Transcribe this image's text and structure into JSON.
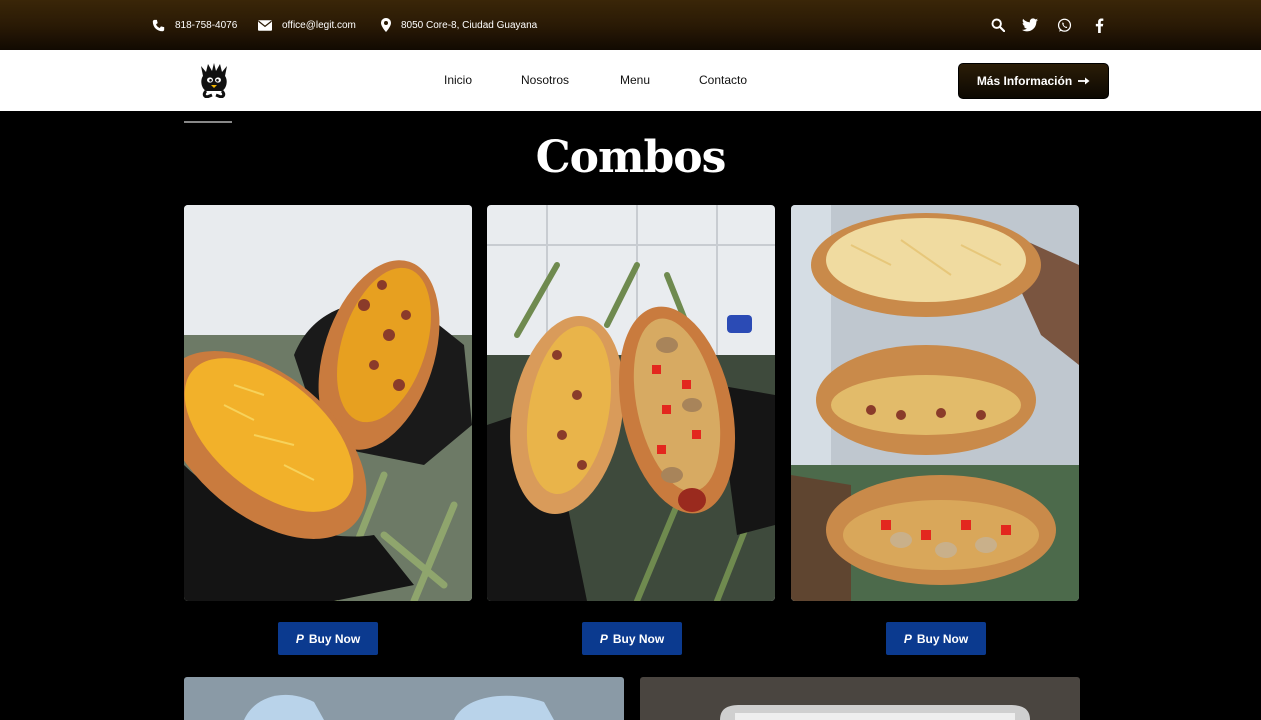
{
  "topbar": {
    "phone": "818-758-4076",
    "email": "office@legit.com",
    "address": "8050 Core-8, Ciudad Guayana",
    "social_icons": [
      "search-icon",
      "twitter-icon",
      "whatsapp-icon",
      "facebook-icon"
    ]
  },
  "nav": {
    "items": [
      {
        "label": "Inicio"
      },
      {
        "label": "Nosotros"
      },
      {
        "label": "Menu"
      },
      {
        "label": "Contacto"
      }
    ],
    "cta_label": "Más Información"
  },
  "main": {
    "title": "Combos",
    "combos": [
      {
        "buy_label": "Buy Now"
      },
      {
        "buy_label": "Buy Now"
      },
      {
        "buy_label": "Buy Now"
      }
    ]
  },
  "colors": {
    "topbar": "#2a1a05",
    "buy_button": "#0b3a8f",
    "background": "#000000"
  }
}
